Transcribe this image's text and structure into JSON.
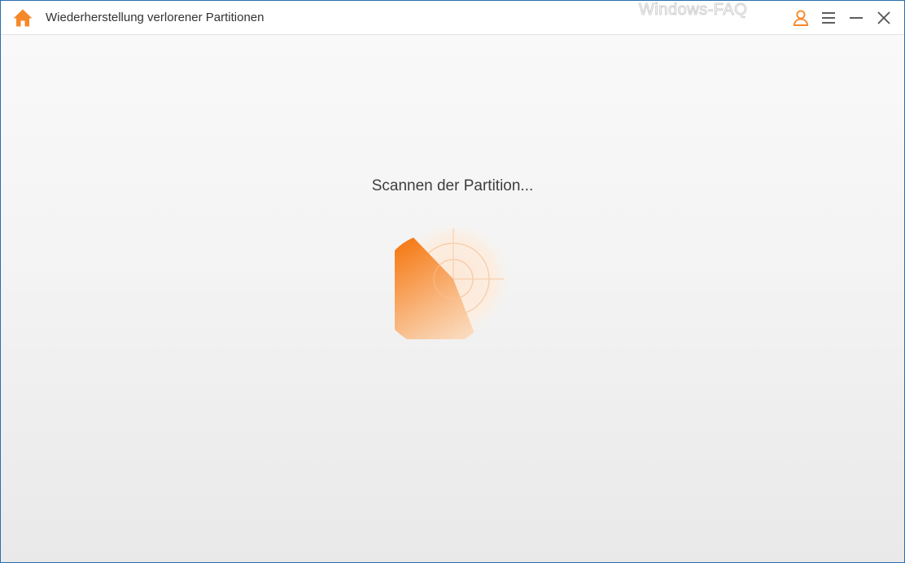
{
  "window": {
    "title": "Wiederherstellung verlorener Partitionen",
    "watermark": "Windows-FAQ"
  },
  "icons": {
    "home": "home-icon",
    "account": "user-icon",
    "menu": "hamburger-menu-icon",
    "minimize": "minimize-icon",
    "close": "close-icon",
    "scan": "radar-scan-icon"
  },
  "main": {
    "status_text": "Scannen der Partition..."
  },
  "colors": {
    "accent": "#f5882a",
    "accent_light": "#fbc9a0",
    "window_border": "#2a6db0",
    "titlebar_bg": "#ffffff",
    "text": "#333333"
  }
}
